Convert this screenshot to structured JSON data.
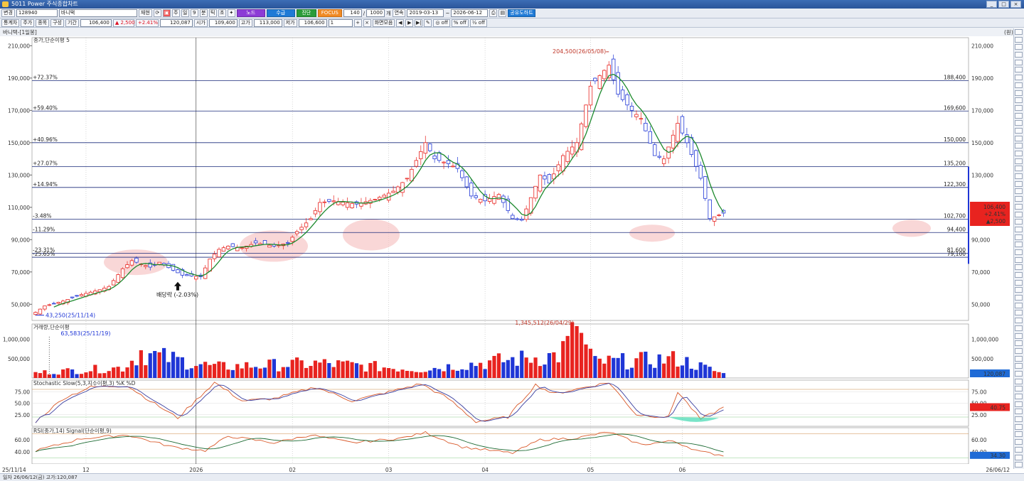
{
  "window": {
    "title": "5011 Power 주식종합차트",
    "controls": [
      "_",
      "□",
      "×"
    ]
  },
  "toolbar": {
    "market": "변경",
    "code": "128940",
    "name": "바니택",
    "buttons": [
      "재현",
      "노드",
      "수급",
      "진단",
      "FOCUS"
    ],
    "count": "140",
    "period_count": "1000",
    "period_unit": "개",
    "mode": "연속",
    "date_from": "2019-03-13",
    "date_to": "2026-06-12",
    "analysis_btn": "공유도하트",
    "timeframe_label": "통계차",
    "timeframes": [
      "주가",
      "종목",
      "구성",
      "기간"
    ],
    "price": "106,400",
    "change": "▲ 2,500",
    "change_pct": "+2.41%",
    "volume": "120,087",
    "open_label": "시가",
    "open": "109,400",
    "high_label": "고가",
    "high": "113,000",
    "low_label": "저가",
    "low": "106,600",
    "step": "1",
    "view_btn": "화면모음",
    "toggles": [
      "off",
      "off",
      "off"
    ]
  },
  "status_bar": {
    "text": "일자 26/06/12(금) 고가:120,087"
  },
  "chart_data": [
    {
      "type": "candlestick",
      "panel": "price",
      "header": "바니택-[1일봉]",
      "legend": "종가,단순이평 5",
      "y_range": [
        40000,
        215000
      ],
      "y_ticks": [
        50000,
        70000,
        90000,
        110000,
        130000,
        150000,
        170000,
        190000,
        210000
      ],
      "y_tick_labels": [
        "50,000",
        "70,000",
        "90,000",
        "110,000",
        "130,000",
        "150,000",
        "170,000",
        "190,000",
        "210,000"
      ],
      "x_start": "2025-11-14",
      "x_end": "2026-06-12",
      "x_tick_labels": [
        {
          "label": "25/11/14",
          "date": "2025-11-14"
        },
        {
          "label": "12",
          "date": "2025-12-01"
        },
        {
          "label": "2026",
          "date": "2026-01-02"
        },
        {
          "label": "02",
          "date": "2026-02-02"
        },
        {
          "label": "03",
          "date": "2026-03-03"
        },
        {
          "label": "04",
          "date": "2026-04-01"
        },
        {
          "label": "05",
          "date": "2026-05-04"
        },
        {
          "label": "06",
          "date": "2026-06-01"
        },
        {
          "label": "26/06/12",
          "date": "2026-06-12"
        }
      ],
      "fib_levels": [
        {
          "pct": "+72.37%",
          "price": 188400,
          "price_label": "188,400"
        },
        {
          "pct": "+59.40%",
          "price": 169600,
          "price_label": "169,600"
        },
        {
          "pct": "+40.96%",
          "price": 150000,
          "price_label": "150,000"
        },
        {
          "pct": "+27.07%",
          "price": 135200,
          "price_label": "135,200"
        },
        {
          "pct": "+14.94%",
          "price": 122300,
          "price_label": "122,300"
        },
        {
          "pct": "-3.48%",
          "price": 102700,
          "price_label": "102,700"
        },
        {
          "pct": "-11.29%",
          "price": 94400,
          "price_label": "94,400"
        },
        {
          "pct": "-23.31%",
          "price": 81600,
          "price_label": "81,600"
        },
        {
          "pct": "-25.65%",
          "price": 79100,
          "price_label": "79,100"
        }
      ],
      "annotations": [
        {
          "text": "204,500(26/05/08)",
          "price": 204500,
          "date": "2026-05-08"
        },
        {
          "text": "43,250(25/11/14)",
          "price": 43250,
          "date": "2025-11-14"
        },
        {
          "text": "배당락 (-2.03%)",
          "price": 66500,
          "date": "2025-12-29"
        }
      ],
      "current": {
        "price": "106,400",
        "change_pct": "+2.41%",
        "change": "▲2,500"
      },
      "close_key_points": [
        [
          "2025-11-14",
          45000
        ],
        [
          "2025-11-18",
          49000
        ],
        [
          "2025-11-24",
          52000
        ],
        [
          "2025-11-28",
          56000
        ],
        [
          "2025-12-04",
          59000
        ],
        [
          "2025-12-08",
          61000
        ],
        [
          "2025-12-11",
          72000
        ],
        [
          "2025-12-15",
          77000
        ],
        [
          "2025-12-19",
          73000
        ],
        [
          "2025-12-23",
          76000
        ],
        [
          "2025-12-26",
          71000
        ],
        [
          "2025-12-30",
          68000
        ],
        [
          "2026-01-05",
          67000
        ],
        [
          "2026-01-07",
          78000
        ],
        [
          "2026-01-09",
          84000
        ],
        [
          "2026-01-13",
          86000
        ],
        [
          "2026-01-16",
          85000
        ],
        [
          "2026-01-21",
          88000
        ],
        [
          "2026-01-27",
          86000
        ],
        [
          "2026-01-30",
          88000
        ],
        [
          "2026-02-03",
          95000
        ],
        [
          "2026-02-06",
          103000
        ],
        [
          "2026-02-10",
          113000
        ],
        [
          "2026-02-13",
          114000
        ],
        [
          "2026-02-20",
          112000
        ],
        [
          "2026-02-26",
          115000
        ],
        [
          "2026-03-04",
          120000
        ],
        [
          "2026-03-09",
          128000
        ],
        [
          "2026-03-13",
          150000
        ],
        [
          "2026-03-17",
          140000
        ],
        [
          "2026-03-20",
          137000
        ],
        [
          "2026-03-24",
          134000
        ],
        [
          "2026-03-27",
          117000
        ],
        [
          "2026-04-01",
          114000
        ],
        [
          "2026-04-06",
          118000
        ],
        [
          "2026-04-09",
          103000
        ],
        [
          "2026-04-13",
          102000
        ],
        [
          "2026-04-17",
          130000
        ],
        [
          "2026-04-21",
          125000
        ],
        [
          "2026-04-24",
          142000
        ],
        [
          "2026-04-29",
          150000
        ],
        [
          "2026-05-04",
          185000
        ],
        [
          "2026-05-08",
          198000
        ],
        [
          "2026-05-12",
          180000
        ],
        [
          "2026-05-15",
          170000
        ],
        [
          "2026-05-19",
          165000
        ],
        [
          "2026-05-22",
          142000
        ],
        [
          "2026-05-26",
          140000
        ],
        [
          "2026-05-29",
          162000
        ],
        [
          "2026-06-02",
          150000
        ],
        [
          "2026-06-05",
          128000
        ],
        [
          "2026-06-09",
          103000
        ],
        [
          "2026-06-12",
          106400
        ]
      ]
    },
    {
      "type": "bar",
      "panel": "volume",
      "legend": "거래량,단순이평",
      "y_range": [
        0,
        1400000
      ],
      "y_ticks": [
        500000,
        1000000
      ],
      "y_tick_labels": [
        "500,000",
        "1,000,000"
      ],
      "annotations": [
        {
          "text": "1,345,512(26/04/29)",
          "value": 1345512,
          "date": "2026-04-29"
        },
        {
          "text": "63,583(25/11/19)",
          "value": 63583,
          "date": "2025-11-19"
        }
      ],
      "current_label": "120,087",
      "key_points": [
        [
          "2025-11-14",
          150000
        ],
        [
          "2025-12-11",
          300000
        ],
        [
          "2025-12-17",
          720000
        ],
        [
          "2026-01-08",
          320000
        ],
        [
          "2026-02-10",
          420000
        ],
        [
          "2026-03-12",
          250000
        ],
        [
          "2026-04-16",
          600000
        ],
        [
          "2026-04-23",
          650000
        ],
        [
          "2026-04-29",
          1345512
        ],
        [
          "2026-05-05",
          450000
        ],
        [
          "2026-05-29",
          550000
        ],
        [
          "2026-06-12",
          120087
        ]
      ]
    },
    {
      "type": "line",
      "panel": "stochastic",
      "legend": "Stochastic Slow(5,3,지수이평,3) %K %D",
      "y_range": [
        0,
        100
      ],
      "y_ticks": [
        25,
        50,
        75
      ],
      "y_tick_labels": [
        "25.00",
        "50.00",
        "75.00"
      ],
      "current_label": "40.75",
      "series": [
        {
          "name": "%K",
          "color": "#d95a2b"
        },
        {
          "name": "%D",
          "color": "#3a3fa0"
        }
      ],
      "k_key_points": [
        [
          "2025-11-14",
          10
        ],
        [
          "2025-11-24",
          60
        ],
        [
          "2025-12-02",
          85
        ],
        [
          "2025-12-12",
          88
        ],
        [
          "2025-12-19",
          55
        ],
        [
          "2025-12-29",
          18
        ],
        [
          "2026-01-08",
          95
        ],
        [
          "2026-01-16",
          55
        ],
        [
          "2026-01-27",
          60
        ],
        [
          "2026-02-09",
          85
        ],
        [
          "2026-02-19",
          55
        ],
        [
          "2026-03-02",
          72
        ],
        [
          "2026-03-12",
          92
        ],
        [
          "2026-03-20",
          60
        ],
        [
          "2026-03-30",
          10
        ],
        [
          "2026-04-08",
          20
        ],
        [
          "2026-04-16",
          90
        ],
        [
          "2026-04-22",
          70
        ],
        [
          "2026-05-01",
          85
        ],
        [
          "2026-05-08",
          95
        ],
        [
          "2026-05-18",
          25
        ],
        [
          "2026-05-27",
          20
        ],
        [
          "2026-05-29",
          75
        ],
        [
          "2026-06-05",
          15
        ],
        [
          "2026-06-12",
          40.75
        ]
      ]
    },
    {
      "type": "line",
      "panel": "rsi",
      "legend": "RSI(종가,14) Signal(단순이평,9)",
      "y_range": [
        20,
        80
      ],
      "y_ticks": [
        40,
        60
      ],
      "y_tick_labels": [
        "40.00",
        "60.00"
      ],
      "current_label": "34.30",
      "series": [
        {
          "name": "RSI",
          "color": "#d95a2b"
        },
        {
          "name": "Signal",
          "color": "#1d6b34"
        }
      ],
      "rsi_key_points": [
        [
          "2025-11-14",
          42
        ],
        [
          "2025-11-28",
          62
        ],
        [
          "2025-12-12",
          68
        ],
        [
          "2025-12-26",
          48
        ],
        [
          "2026-01-06",
          42
        ],
        [
          "2026-01-13",
          66
        ],
        [
          "2026-01-27",
          55
        ],
        [
          "2026-02-06",
          68
        ],
        [
          "2026-02-19",
          55
        ],
        [
          "2026-03-06",
          63
        ],
        [
          "2026-03-13",
          72
        ],
        [
          "2026-03-25",
          48
        ],
        [
          "2026-04-09",
          38
        ],
        [
          "2026-04-17",
          60
        ],
        [
          "2026-04-29",
          63
        ],
        [
          "2026-05-08",
          73
        ],
        [
          "2026-05-19",
          52
        ],
        [
          "2026-05-28",
          58
        ],
        [
          "2026-06-05",
          40
        ],
        [
          "2026-06-12",
          34.3
        ]
      ]
    }
  ],
  "colors": {
    "up": "#e8231f",
    "down": "#1f36d6",
    "ma5": "#1d8a2e",
    "fib_line": "#1a2a7a",
    "highlight": "#f6c6c6",
    "accent_purple": "#8c3bd6"
  }
}
